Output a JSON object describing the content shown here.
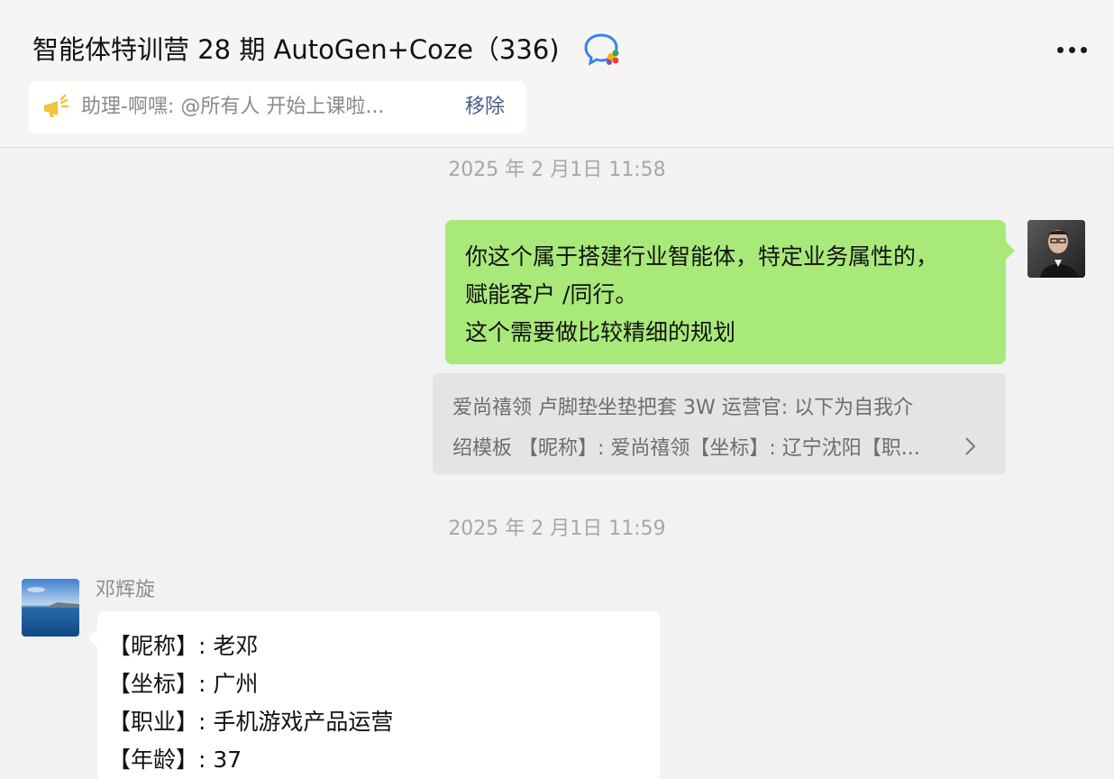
{
  "header": {
    "title": "智能体特训营 28 期 AutoGen+Coze（336)",
    "chat_badge_icon": "group-chat-icon",
    "more_icon": "more-dots-icon"
  },
  "announcement": {
    "icon": "announcement-icon",
    "text": "助理-啊嘿: @所有人 开始上课啦...",
    "remove_label": "移除"
  },
  "messages": {
    "timestamp_1": "2025 年 2 月1日 11:58",
    "self_message": {
      "lines": [
        "你这个属于搭建行业智能体，特定业务属性的，",
        "赋能客户 /同行。",
        "这个需要做比较精细的规划"
      ]
    },
    "quote": {
      "lines": [
        "爱尚禧领 卢脚垫坐垫把套 3W 运营官: 以下为自我介",
        "绍模板 【昵称】:  爱尚禧领【坐标】:  辽宁沈阳【职..."
      ],
      "chevron_icon": "chevron-right-icon"
    },
    "timestamp_2": "2025 年 2 月1日 11:59",
    "other_message": {
      "sender": "邓辉旋",
      "lines": [
        "【昵称】:  老邓",
        "【坐标】:  广州",
        "【职业】:  手机游戏产品运营",
        "【年龄】:  37"
      ]
    }
  },
  "colors": {
    "self_bubble": "#a9e97a",
    "other_bubble": "#ffffff",
    "quote_bg": "#e4e4e4",
    "accent_link": "#4a5d85",
    "background": "#f2f2f2"
  }
}
